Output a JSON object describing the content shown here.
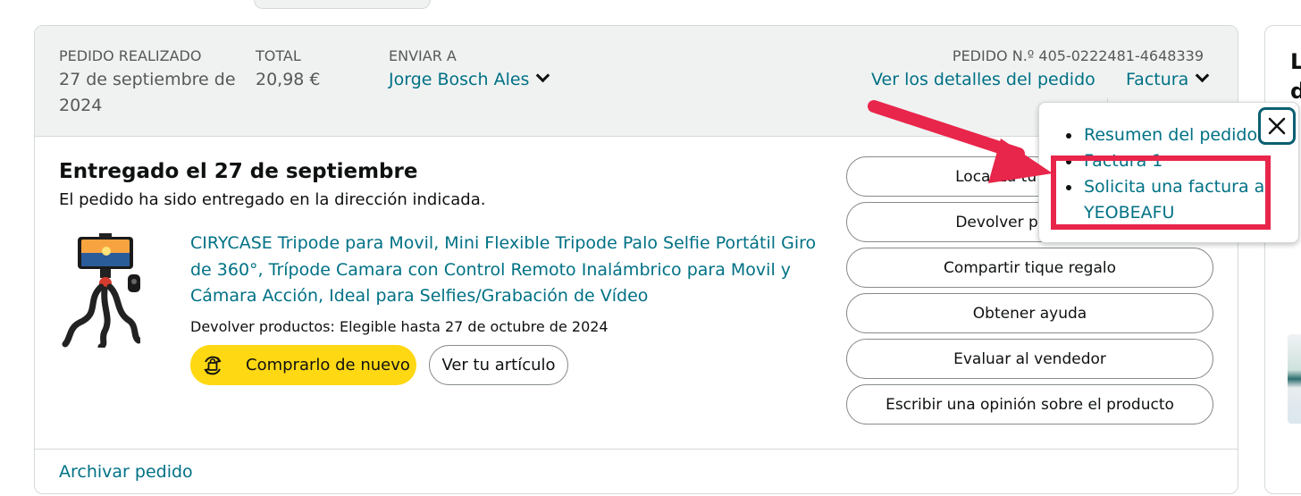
{
  "header": {
    "order_placed_label": "PEDIDO REALIZADO",
    "order_date_line1": "27 de septiembre de",
    "order_date_line2": "2024",
    "total_label": "TOTAL",
    "total_value": "20,98 €",
    "ship_to_label": "ENVIAR A",
    "ship_to_name": "Jorge Bosch Ales",
    "order_number": "PEDIDO N.º 405-0222481-4648339",
    "details_link": "Ver los detalles del pedido",
    "invoice_link": "Factura"
  },
  "status": {
    "title": "Entregado el 27 de septiembre",
    "subtitle": "El pedido ha sido entregado en la dirección indicada."
  },
  "product": {
    "title": "CIRYCASE Tripode para Movil, Mini Flexible Tripode Palo Selfie Portátil Giro de 360°, Trípode Camara con Control Remoto Inalámbrico para Movil y Cámara Acción, Ideal para Selfies/Grabación de Vídeo",
    "return_info": "Devolver productos: Elegible hasta 27 de octubre de 2024",
    "buy_again": "Comprarlo de nuevo",
    "view_item": "Ver tu artículo"
  },
  "actions": [
    "Localiza tu paquete",
    "Devolver productos",
    "Compartir tique regalo",
    "Obtener ayuda",
    "Evaluar al vendedor",
    "Escribir una opinión sobre el producto"
  ],
  "footer": {
    "archive": "Archivar pedido"
  },
  "invoice_popover": {
    "items": [
      "Resumen del pedido",
      "Factura 1",
      "Solicita una factura a YEOBEAFU"
    ],
    "close_icon": "close-icon"
  },
  "side_panel": {
    "heading_line1": "L",
    "heading_line2": "d"
  },
  "colors": {
    "link": "#007185",
    "buy_again": "#ffd814",
    "highlight": "#e8254a",
    "header_bg": "#f0f2f2"
  }
}
